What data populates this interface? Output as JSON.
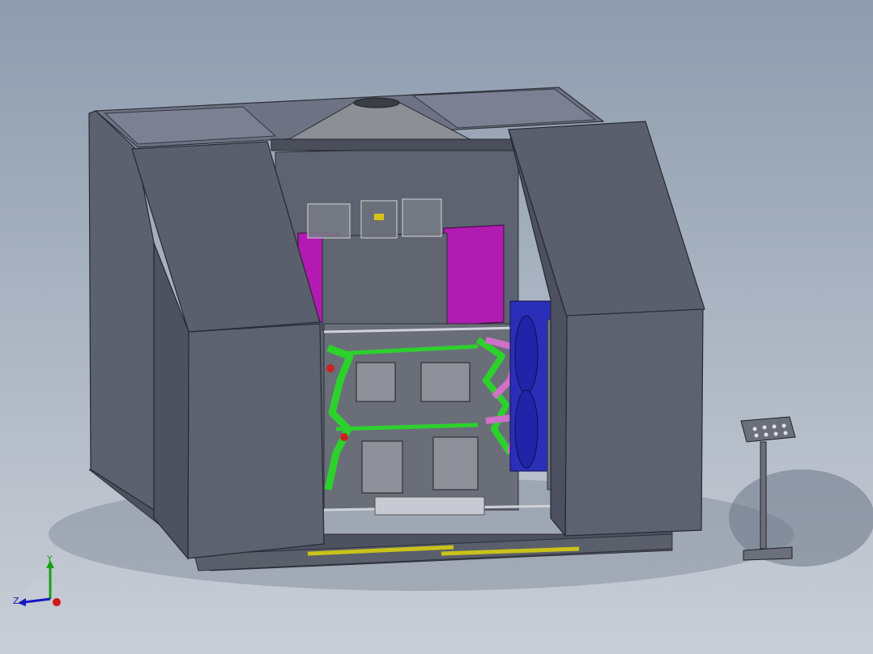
{
  "viewport": {
    "background_top": "#8e9cae",
    "background_bottom": "#c9ced6",
    "model_colors": {
      "enclosure": "#5a5f6e",
      "enclosure_dark": "#3f4350",
      "top_panel": "#6e7484",
      "hopper": "#8a8e94",
      "magenta_block": "#b01cb0",
      "green_linkage": "#2cd12c",
      "blue_wheel": "#2a2eb8",
      "yellow_rod": "#c9c21a",
      "steel": "#9aa0a8"
    }
  },
  "triad": {
    "icon": "axis-triad-icon",
    "x_label": "",
    "y_label": "Y",
    "z_label": "Z",
    "x_color": "#d01818",
    "y_color": "#18a018",
    "z_color": "#1818c0"
  }
}
